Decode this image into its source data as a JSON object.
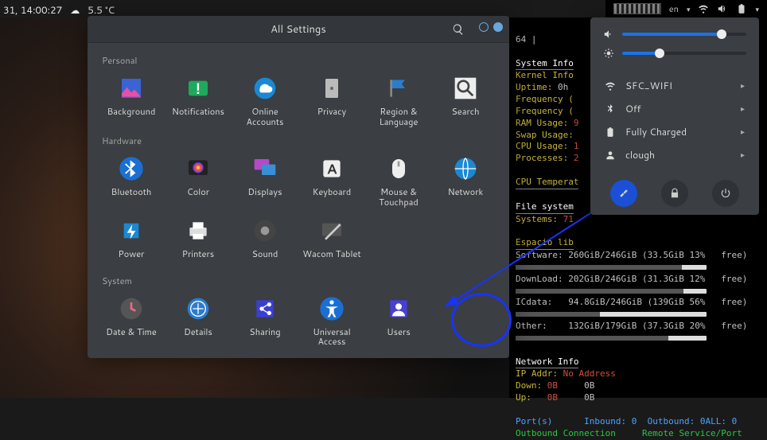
{
  "topbar": {
    "clock": "31, 14:00:27",
    "temp": "5.5 °C",
    "lang": "en",
    "right_64": "64 |"
  },
  "settings": {
    "title": "All Settings",
    "sections": {
      "personal": "Personal",
      "hardware": "Hardware",
      "system": "System"
    },
    "items": {
      "background": "Background",
      "notifications": "Notifications",
      "online_accounts": "Online Accounts",
      "privacy": "Privacy",
      "region": "Region & Language",
      "search": "Search",
      "bluetooth": "Bluetooth",
      "color": "Color",
      "displays": "Displays",
      "keyboard": "Keyboard",
      "mouse": "Mouse & Touchpad",
      "network": "Network",
      "power": "Power",
      "printers": "Printers",
      "sound": "Sound",
      "wacom": "Wacom Tablet",
      "datetime": "Date & Time",
      "details": "Details",
      "sharing": "Sharing",
      "ua": "Universal Access",
      "users": "Users"
    }
  },
  "quicksettings": {
    "volume_pct": 80,
    "brightness_pct": 30,
    "wifi": "SFC_WIFI",
    "bt": "Off",
    "battery": "Fully Charged",
    "user": "clough"
  },
  "conky": {
    "sys_info": "System Info",
    "kernel": "Kernel Info",
    "uptime_lbl": "Uptime:",
    "uptime_val": "0h",
    "freq1": "Frequency (",
    "freq2": "Frequency (",
    "ram_lbl": "RAM Usage:",
    "swap_lbl": "Swap Usage:",
    "cpu_lbl": "CPU Usage:",
    "proc_lbl": "Processes:",
    "cpu_temp": "CPU Temperat",
    "fs": "File system",
    "systems_lbl": "Systems:",
    "systems_val": "71",
    "espacio": "Espacio lib",
    "software_lbl": "Software:",
    "software_val": "260GiB/246GiB (33.5GiB 13%   free)",
    "download_lbl": "DownLoad:",
    "download_val": "202GiB/246GiB (31.3GiB 12%   free)",
    "icdata_lbl": "ICdata:",
    "icdata_val": "94.8GiB/246GiB (139GiB 56%   free)",
    "other_lbl": "Other:",
    "other_val": "132GiB/179GiB (37.3GiB 20%   free)",
    "net_info": "Network Info",
    "ip_lbl": "IP Addr:",
    "ip_val": "No Address",
    "down_lbl": "Down:",
    "down_val": "0B",
    "down_total": "0B",
    "up_lbl": "Up:",
    "up_val": "0B",
    "up_total": "0B",
    "ports": "Port(s)",
    "inbound": "Inbound: 0",
    "outbound": "Outbound: 0",
    "all": "ALL: 0",
    "outconn": "Outbound Connection",
    "remote": "Remote Service/Port"
  }
}
